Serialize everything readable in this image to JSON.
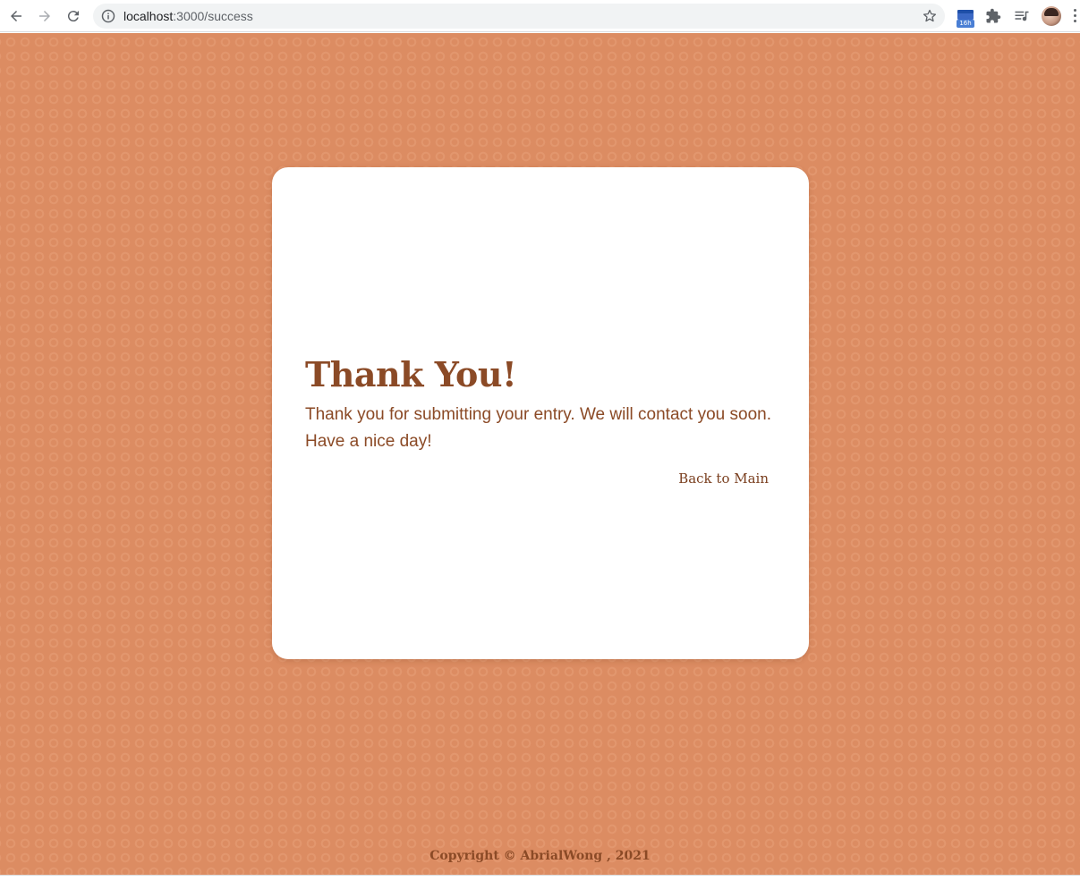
{
  "browser": {
    "url_host": "localhost",
    "url_path": ":3000/success",
    "extension_badge": "16h"
  },
  "card": {
    "title": "Thank You!",
    "message": "Thank you for submitting your entry. We will contact you soon. Have a nice day!",
    "back_link": "Back to Main"
  },
  "footer": {
    "copyright": "Copyright © AbrialWong , 2021"
  },
  "colors": {
    "background": "#dc8c62",
    "accent_text": "#8b4a26",
    "card": "#ffffff"
  },
  "icons": [
    "back-arrow-icon",
    "forward-arrow-icon",
    "reload-icon",
    "info-icon",
    "star-icon",
    "calendar-extension-icon",
    "puzzle-extensions-icon",
    "media-queue-icon",
    "avatar",
    "menu-dots-icon"
  ]
}
